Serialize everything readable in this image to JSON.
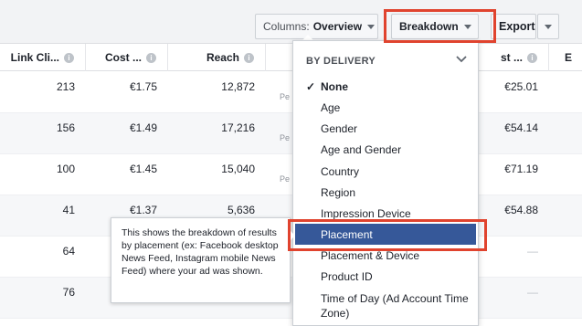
{
  "toolbar": {
    "columns_label": "Columns:",
    "columns_value": "Overview",
    "breakdown_label": "Breakdown",
    "export_label": "Export"
  },
  "table": {
    "headers": [
      "Link Cli...",
      "Cost ...",
      "Reach",
      "",
      "st ...",
      "E"
    ],
    "rows": [
      {
        "link_clicks": "213",
        "cost": "€1.75",
        "reach": "12,872",
        "pe": "Pe",
        "cost2": "€25.01"
      },
      {
        "link_clicks": "156",
        "cost": "€1.49",
        "reach": "17,216",
        "pe": "Pe",
        "cost2": "€54.14"
      },
      {
        "link_clicks": "100",
        "cost": "€1.45",
        "reach": "15,040",
        "pe": "Pe",
        "cost2": "€71.19"
      },
      {
        "link_clicks": "41",
        "cost": "€1.37",
        "reach": "5,636",
        "pe": "",
        "cost2": "€54.88"
      },
      {
        "link_clicks": "64",
        "cost": "",
        "reach": "",
        "pe": "",
        "cost2": "—"
      },
      {
        "link_clicks": "76",
        "cost": "",
        "reach": "",
        "pe": "",
        "cost2": "—"
      }
    ]
  },
  "breakdown_menu": {
    "header": "BY DELIVERY",
    "check": "✓",
    "items": [
      "None",
      "Age",
      "Gender",
      "Age and Gender",
      "Country",
      "Region",
      "Impression Device",
      "Placement",
      "Placement & Device",
      "Product ID",
      "Time of Day (Ad Account Time Zone)"
    ],
    "checked_item": "None",
    "selected_item": "Placement"
  },
  "tooltip": {
    "text": "This shows the breakdown of results by placement (ex: Facebook desktop News Feed, Instagram mobile News Feed) where your ad was shown."
  },
  "colors": {
    "highlight_box": "#e0432e",
    "selected_bg": "#365899"
  },
  "icons": {
    "info": "info-icon",
    "caret": "caret-down-icon",
    "chevron": "chevron-down-icon",
    "check": "checkmark-icon"
  }
}
